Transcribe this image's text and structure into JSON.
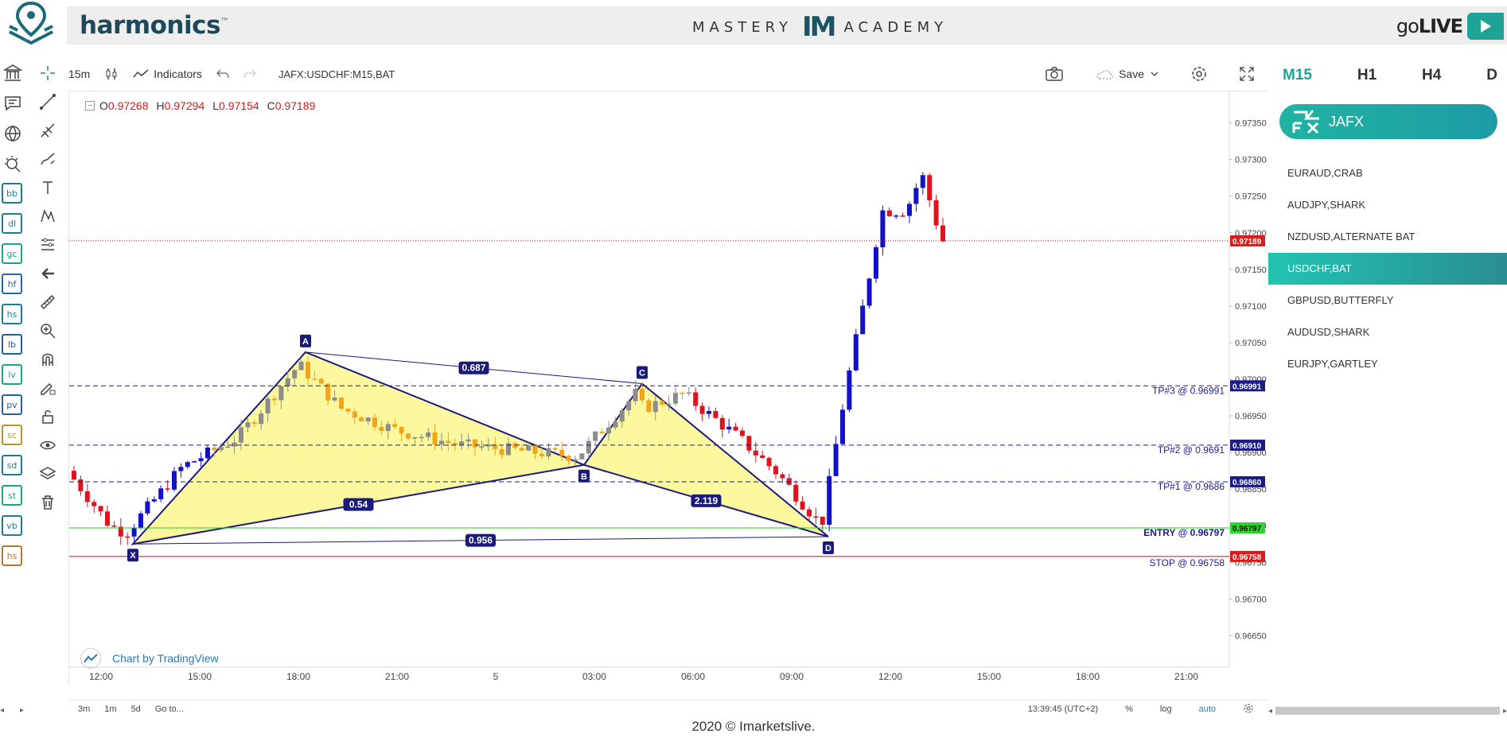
{
  "header": {
    "brand": "harmonics",
    "brand_tm": "™",
    "academy_left": "MASTERY",
    "academy_mark": "IM",
    "academy_right": "ACADEMY",
    "golive_light": "go",
    "golive_bold": "LIVE"
  },
  "toolbar": {
    "interval": "15m",
    "indicators_label": "Indicators",
    "symbol": "JAFX:USDCHF:M15,BAT",
    "save_label": "Save"
  },
  "left_toolbar": {
    "badges": [
      "bb",
      "dl",
      "gc",
      "hf",
      "hs",
      "lb",
      "lv",
      "pv",
      "sc",
      "sd",
      "st",
      "vb",
      "hs"
    ]
  },
  "legend": {
    "o_label": "O",
    "o_value": "0.97268",
    "h_label": "H",
    "h_value": "0.97294",
    "l_label": "L",
    "l_value": "0.97154",
    "c_label": "C",
    "c_value": "0.97189"
  },
  "chart_credit": "Chart by TradingView",
  "chart_data": {
    "type": "candlestick",
    "y_ticks": [
      "0.97350",
      "0.97300",
      "0.97250",
      "0.97200",
      "0.97150",
      "0.97100",
      "0.97050",
      "0.97000",
      "0.96950",
      "0.96900",
      "0.96850",
      "0.96800",
      "0.96750",
      "0.96700",
      "0.96650"
    ],
    "ylim": [
      0.9662,
      0.9738
    ],
    "x_ticks": [
      "12:00",
      "15:00",
      "18:00",
      "21:00",
      "5",
      "03:00",
      "06:00",
      "09:00",
      "12:00",
      "15:00",
      "18:00",
      "21:00"
    ],
    "last_price": "0.97189",
    "levels": [
      {
        "label": "TP#3 @ 0.96991",
        "value": 0.96991,
        "tag": "0.96991",
        "color": "#1c1c8c"
      },
      {
        "label": "TP#2 @ 0.9691",
        "value": 0.9691,
        "tag": "0.96910",
        "color": "#1c1c8c"
      },
      {
        "label": "TP#1 @ 0.9686",
        "value": 0.9686,
        "tag": "0.96860",
        "color": "#1c1c8c"
      },
      {
        "label": "ENTRY @ 0.96797",
        "value": 0.96797,
        "tag": "0.96797",
        "color": "#2fc42f"
      },
      {
        "label": "STOP @ 0.96758",
        "value": 0.96758,
        "tag": "0.96758",
        "color": "#cc1111"
      }
    ],
    "pattern": {
      "name": "BAT",
      "points": [
        {
          "label": "X",
          "value": 0.96775
        },
        {
          "label": "A",
          "value": 0.97037
        },
        {
          "label": "B",
          "value": 0.96883
        },
        {
          "label": "C",
          "value": 0.96994
        },
        {
          "label": "D",
          "value": 0.96785
        }
      ],
      "ratios": [
        {
          "label": "0.687"
        },
        {
          "label": "0.54"
        },
        {
          "label": "2.119"
        },
        {
          "label": "0.956"
        }
      ]
    }
  },
  "range_bar": {
    "ranges": [
      "3m",
      "1m",
      "5d",
      "Go to..."
    ],
    "time": "13:39:45 (UTC+2)",
    "percent": "%",
    "log": "log",
    "auto": "auto"
  },
  "timeframes": [
    "M15",
    "H1",
    "H4",
    "D"
  ],
  "broker": {
    "label": "JAFX"
  },
  "patterns": [
    "EURAUD,CRAB",
    "AUDJPY,SHARK",
    "NZDUSD,ALTERNATE BAT",
    "USDCHF,BAT",
    "GBPUSD,BUTTERFLY",
    "AUDUSD,SHARK",
    "EURJPY,GARTLEY"
  ],
  "selected_pattern": 3,
  "footer": "2020 © Imarketslive.",
  "colors": {
    "accent": "#1fa396",
    "bull": "#1111cc",
    "bear": "#e0121d",
    "neutral_up": "#8c8c8c",
    "neutral_down": "#f2a41e",
    "pattern_fill": "#fbf78c",
    "pattern_line": "#1a1a7a"
  }
}
